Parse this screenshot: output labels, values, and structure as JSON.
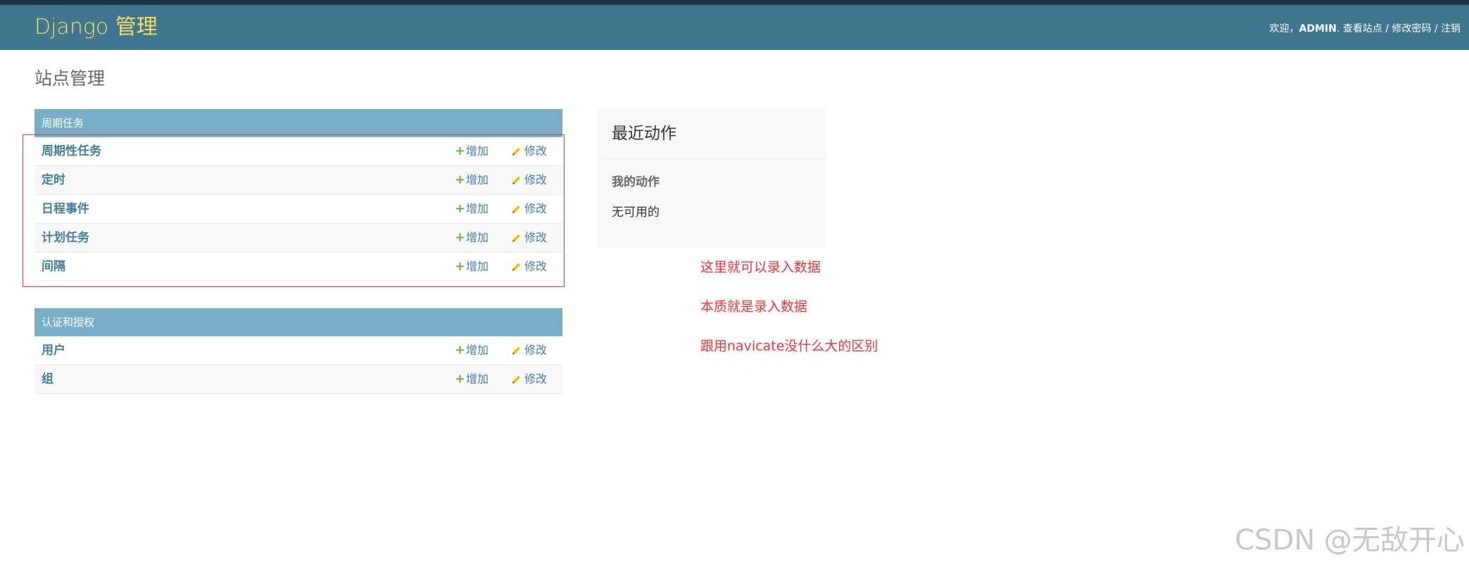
{
  "header": {
    "brand": "Django 管理",
    "welcome": "欢迎，",
    "username": "ADMIN",
    "username_suffix": ".",
    "view_site": "查看站点",
    "sep1": " / ",
    "change_password": "修改密码",
    "sep2": " / ",
    "logout": "注销"
  },
  "page_title": "站点管理",
  "modules": [
    {
      "caption": "周期任务",
      "rows": [
        {
          "name": "周期性任务",
          "add": "增加",
          "change": "修改"
        },
        {
          "name": "定时",
          "add": "增加",
          "change": "修改"
        },
        {
          "name": "日程事件",
          "add": "增加",
          "change": "修改"
        },
        {
          "name": "计划任务",
          "add": "增加",
          "change": "修改"
        },
        {
          "name": "间隔",
          "add": "增加",
          "change": "修改"
        }
      ]
    },
    {
      "caption": "认证和授权",
      "rows": [
        {
          "name": "用户",
          "add": "增加",
          "change": "修改"
        },
        {
          "name": "组",
          "add": "增加",
          "change": "修改"
        }
      ]
    }
  ],
  "recent_actions": {
    "title": "最近动作",
    "subtitle": "我的动作",
    "empty": "无可用的"
  },
  "annotations": [
    "这里就可以录入数据",
    "本质就是录入数据",
    "跟用navicate没什么大的区别"
  ],
  "watermark": "CSDN @无敌开心",
  "colors": {
    "header_bg": "#417690",
    "brand": "#f5dd5d",
    "caption_bg": "#79aec8",
    "link": "#447e9b",
    "add_icon": "#6cb33f",
    "change_icon": "#efb80b",
    "annotation": "#e8333a"
  }
}
